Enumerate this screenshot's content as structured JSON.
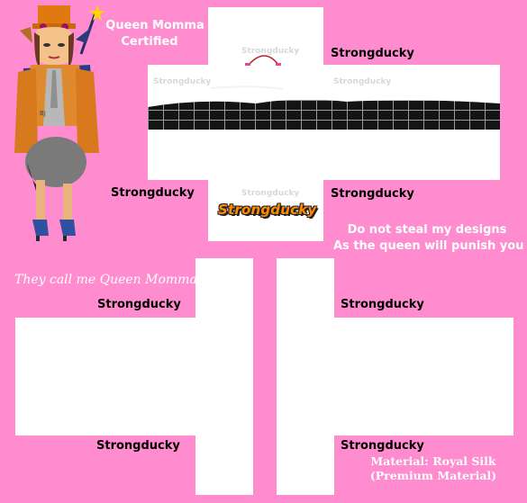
{
  "header": {
    "title_line1": "Queen Momma",
    "title_line2": "Certified"
  },
  "labels": {
    "torso_top_right": "Strongducky",
    "torso_bottom_left": "Strongducky",
    "torso_bottom_right": "Strongducky",
    "left_arm_top": "Strongducky",
    "left_arm_bottom": "Strongducky",
    "right_arm_top": "Strongducky",
    "right_arm_bottom": "Strongducky"
  },
  "logo_text": "Strongducky",
  "tagline": "They call me Queen Momma",
  "warning": {
    "line1": "Do not steal my designs",
    "line2": "As the queen will punish you"
  },
  "material": {
    "line1": "Material: Royal Silk",
    "line2": "(Premium Material)"
  },
  "watermarks": [
    "Strongducky",
    "Strongducky",
    "Strongducky",
    "Strongducky"
  ],
  "colors": {
    "background": "#ff8ccf",
    "template": "#ffffff",
    "logo_orange": "#ff8a00",
    "stripe": "#151515"
  },
  "icons": [
    "avatar-image",
    "plaid-stripe"
  ]
}
